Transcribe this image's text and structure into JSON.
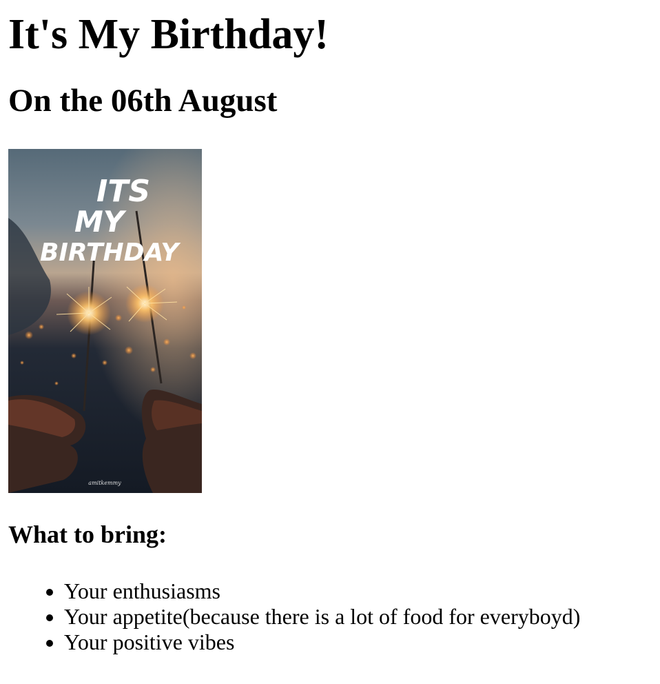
{
  "page": {
    "title": "It's My Birthday!",
    "subtitle": "On the 06th August",
    "section_heading": "What to bring:",
    "bring_items": [
      "Your enthusiasms",
      "Your appetite(because there is a lot of food for everyboyd)",
      "Your positive vibes"
    ]
  },
  "poster": {
    "line1": "ITS",
    "line2": "MY",
    "line3": "BIRTHDAY",
    "signature": "amitkemmy",
    "colors": {
      "sky_top": "#5a6f7c",
      "sky_mid": "#8a8e8c",
      "horizon_glow": "#d6a77e",
      "ground": "#1b2330",
      "sparkle": "#ffd28a",
      "text": "#ffffff"
    }
  }
}
